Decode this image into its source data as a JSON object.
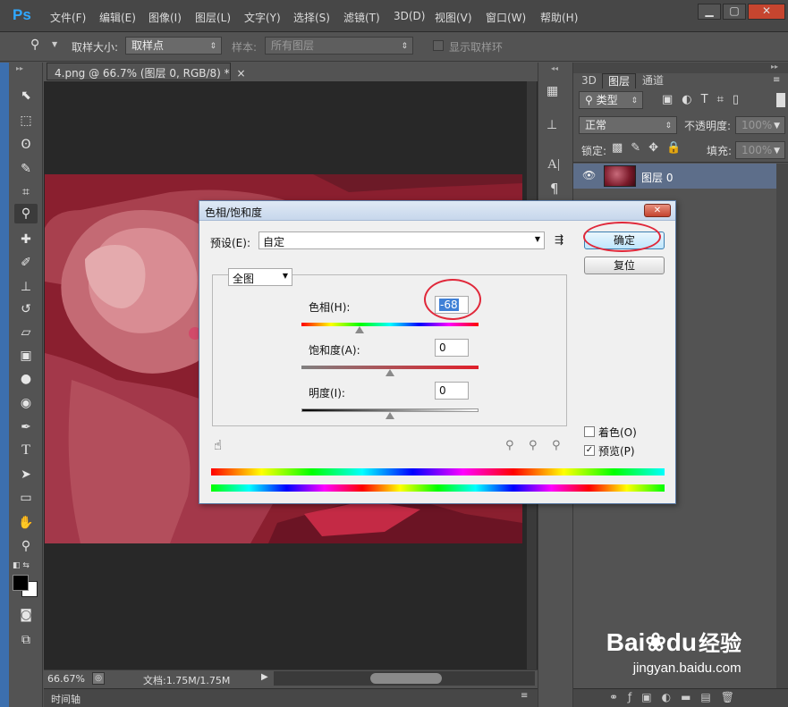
{
  "app": {
    "logo": "Ps",
    "menu": [
      "文件(F)",
      "编辑(E)",
      "图像(I)",
      "图层(L)",
      "文字(Y)",
      "选择(S)",
      "滤镜(T)",
      "3D(D)",
      "视图(V)",
      "窗口(W)",
      "帮助(H)"
    ],
    "min": "▁",
    "max": "▢",
    "close": "✕"
  },
  "options": {
    "eyedropper_icon": "eyedropper-icon",
    "sample_size_label": "取样大小:",
    "sample_size_value": "取样点",
    "sample_label": "样本:",
    "sample_value": "所有图层",
    "show_ring_label": "显示取样环"
  },
  "document": {
    "tab_title": "4.png @ 66.7% (图层 0, RGB/8) *",
    "tab_close": "×",
    "zoom": "66.67%",
    "doc_info": "文档:1.75M/1.75M",
    "timeline_label": "时间轴"
  },
  "panels": {
    "tabs": [
      "3D",
      "图层",
      "通道"
    ],
    "filter_label": "类型",
    "blend_mode": "正常",
    "opacity_label": "不透明度:",
    "opacity_value": "100%",
    "lock_label": "锁定:",
    "fill_label": "填充:",
    "fill_value": "100%",
    "layer_name": "图层 0"
  },
  "dialog": {
    "title": "色相/饱和度",
    "preset_label": "预设(E):",
    "preset_value": "自定",
    "channel_value": "全图",
    "hue_label": "色相(H):",
    "hue_value": "-68",
    "saturation_label": "饱和度(A):",
    "saturation_value": "0",
    "lightness_label": "明度(I):",
    "lightness_value": "0",
    "ok_label": "确定",
    "reset_label": "复位",
    "colorize_label": "着色(O)",
    "preview_label": "预览(P)",
    "colorize_checked": false,
    "preview_checked": true,
    "hue_slider_fraction": 0.33,
    "saturation_slider_fraction": 0.5,
    "lightness_slider_fraction": 0.5
  },
  "watermark": {
    "brand": "Bai",
    "brand2": "du",
    "jingyan": "经验",
    "url": "jingyan.baidu.com"
  },
  "colors": {
    "ps_blue": "#30a8ff",
    "canvas_red": "#8b2030",
    "highlight": "#e0283a"
  }
}
